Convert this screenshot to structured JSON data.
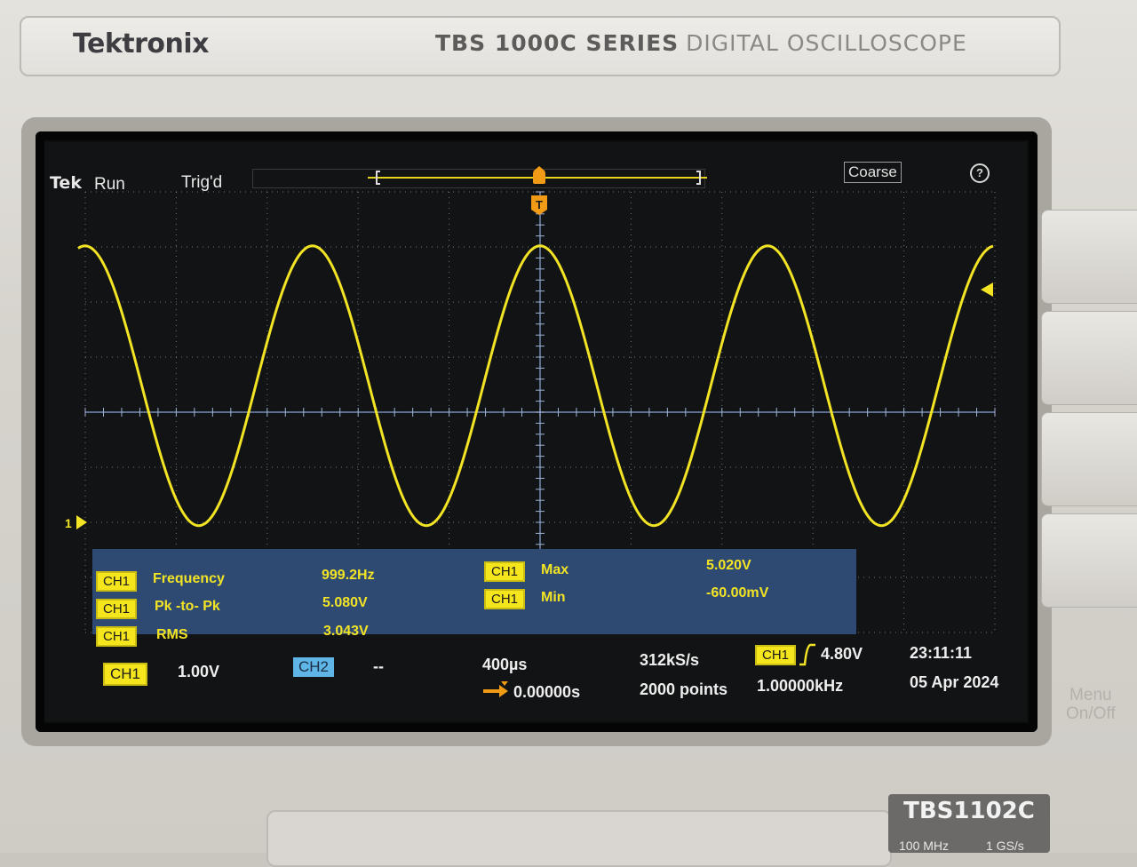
{
  "device": {
    "brand": "Tektronix",
    "series": "TBS 1000C SERIES",
    "series_desc": "DIGITAL OSCILLOSCOPE",
    "model": "TBS1102C",
    "spec_bandwidth": "100 MHz",
    "spec_sample": "1 GS/s",
    "menu_label_1": "Menu",
    "menu_label_2": "On/Off"
  },
  "status_bar": {
    "tek": "Tek",
    "run_state": "Run",
    "trigger_state": "Trig'd",
    "knob_mode": "Coarse",
    "help_glyph": "?"
  },
  "markers": {
    "trigger_pos": "T",
    "channel1_ground": "1"
  },
  "measurements": {
    "left": [
      {
        "channel": "CH1",
        "name": "Frequency",
        "value": "999.2Hz"
      },
      {
        "channel": "CH1",
        "name": "Pk -to- Pk",
        "value": "5.080V"
      },
      {
        "channel": "CH1",
        "name": "RMS",
        "value": "3.043V"
      }
    ],
    "right": [
      {
        "channel": "CH1",
        "name": "Max",
        "value": "5.020V"
      },
      {
        "channel": "CH1",
        "name": "Min",
        "value": "-60.00mV"
      }
    ]
  },
  "bottom_bar": {
    "ch1_label": "CH1",
    "ch1_scale": "1.00V",
    "ch2_label": "CH2",
    "ch2_scale": "--",
    "timebase": "400µs",
    "horiz_position": "0.00000s",
    "sample_rate": "312kS/s",
    "record_length": "2000 points",
    "trigger_source": "CH1",
    "trigger_level": "4.80V",
    "trigger_freq": "1.00000kHz",
    "time": "23:11:11",
    "date": "05 Apr 2024"
  },
  "waveform": {
    "color": "#f2e425",
    "frequency_hz": 999.2,
    "max_v": 5.02,
    "min_v": -0.06,
    "volts_per_div": 1.0,
    "time_per_div_us": 400
  },
  "colors": {
    "trace": "#f2e425",
    "ch2": "#5fb6e6",
    "grid": "#9aa0a8",
    "measure_panel": "#2e4a73",
    "trigger_marker": "#f09a16"
  }
}
